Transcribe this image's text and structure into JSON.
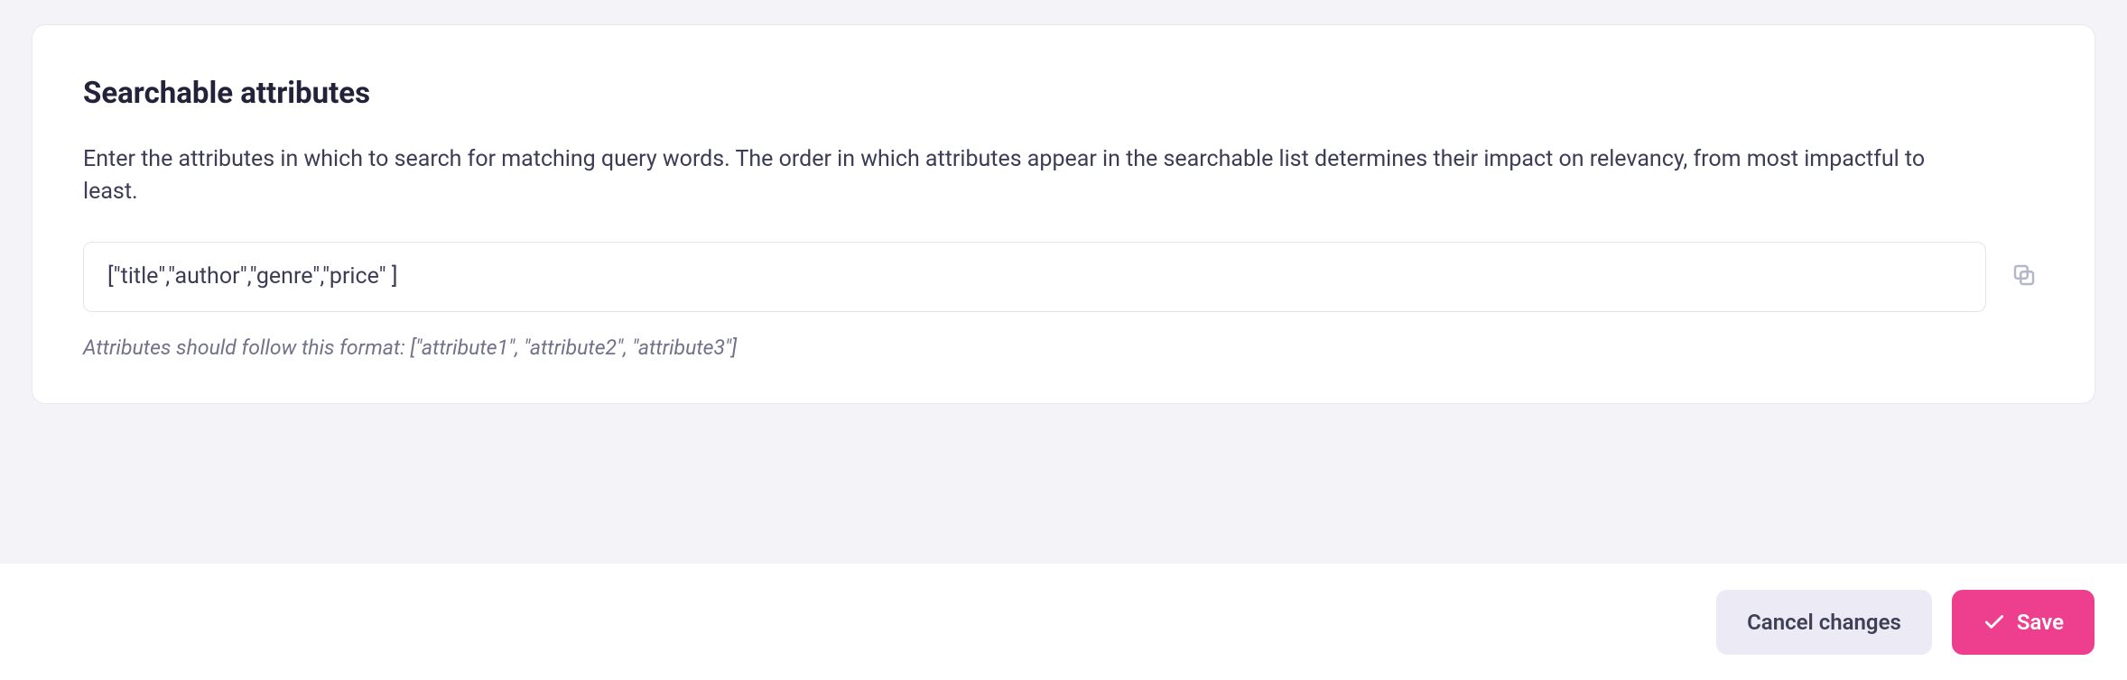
{
  "card": {
    "title": "Searchable attributes",
    "description": "Enter the attributes in which to search for matching query words. The order in which attributes appear in the searchable list determines their impact on relevancy, from most impactful to least.",
    "input_value": "[\"title\",\"author\",\"genre\",\"price\" ]",
    "hint": "Attributes should follow this format: [\"attribute1\", \"attribute2\", \"attribute3\"]"
  },
  "footer": {
    "cancel_label": "Cancel changes",
    "save_label": "Save"
  }
}
